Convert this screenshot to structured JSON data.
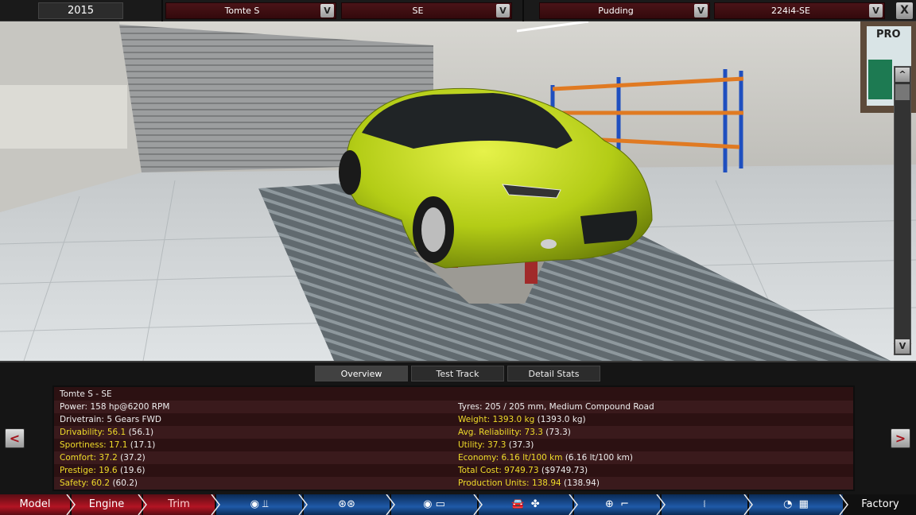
{
  "top_bar": {
    "year": "2015",
    "model_select": "Tomte S",
    "trim_select": "SE",
    "engine_family_select": "Pudding",
    "engine_variant_select": "224i4-SE",
    "dropdown_arrow": "V",
    "close_label": "X"
  },
  "scene": {
    "scroll_up": "^",
    "scroll_down": "V",
    "poster_text": "PRO",
    "car_color": "#b9d21a"
  },
  "tabs": [
    "Overview",
    "Test Track",
    "Detail Stats"
  ],
  "stats": {
    "title": "Tomte S - SE",
    "left": [
      {
        "label": "Power:",
        "value": "158 hp@6200 RPM",
        "extra": ""
      },
      {
        "label": "Drivetrain:",
        "value": "5 Gears FWD",
        "extra": ""
      },
      {
        "label": "Drivability:",
        "value": "56.1",
        "extra": "(56.1)"
      },
      {
        "label": "Sportiness:",
        "value": "17.1",
        "extra": "(17.1)"
      },
      {
        "label": "Comfort:",
        "value": "37.2",
        "extra": "(37.2)"
      },
      {
        "label": "Prestige:",
        "value": "19.6",
        "extra": "(19.6)"
      },
      {
        "label": "Safety:",
        "value": "60.2",
        "extra": "(60.2)"
      }
    ],
    "right": [
      {
        "label": "Tyres:",
        "value": "205 / 205 mm, Medium Compound Road",
        "extra": ""
      },
      {
        "label": "Weight:",
        "value": "1393.0 kg",
        "extra": "(1393.0 kg)"
      },
      {
        "label": "Avg. Reliability:",
        "value": "73.3",
        "extra": "(73.3)"
      },
      {
        "label": "Utility:",
        "value": "37.3",
        "extra": "(37.3)"
      },
      {
        "label": "Economy:",
        "value": "6.16 lt/100 km",
        "extra": "(6.16 lt/100 km)"
      },
      {
        "label": "Total Cost:",
        "value": "9749.73",
        "extra": "($9749.73)"
      },
      {
        "label": "Production Units:",
        "value": "138.94",
        "extra": "(138.94)"
      }
    ]
  },
  "nav": {
    "prev": "<",
    "next": ">",
    "model": "Model",
    "engine": "Engine",
    "trim": "Trim",
    "factory": "Factory",
    "icons": [
      "gearbox-icon",
      "wheels-icon",
      "chassis-icon",
      "car-body-icon",
      "fan-icon",
      "steering-wheel-icon",
      "seat-icon",
      "suspension-icon",
      "speedometer-icon",
      "checkered-flag-icon"
    ]
  },
  "colors": {
    "accent_red": "#b31423",
    "accent_blue": "#1f5aa8",
    "stat_yellow": "#f0dc2a"
  }
}
